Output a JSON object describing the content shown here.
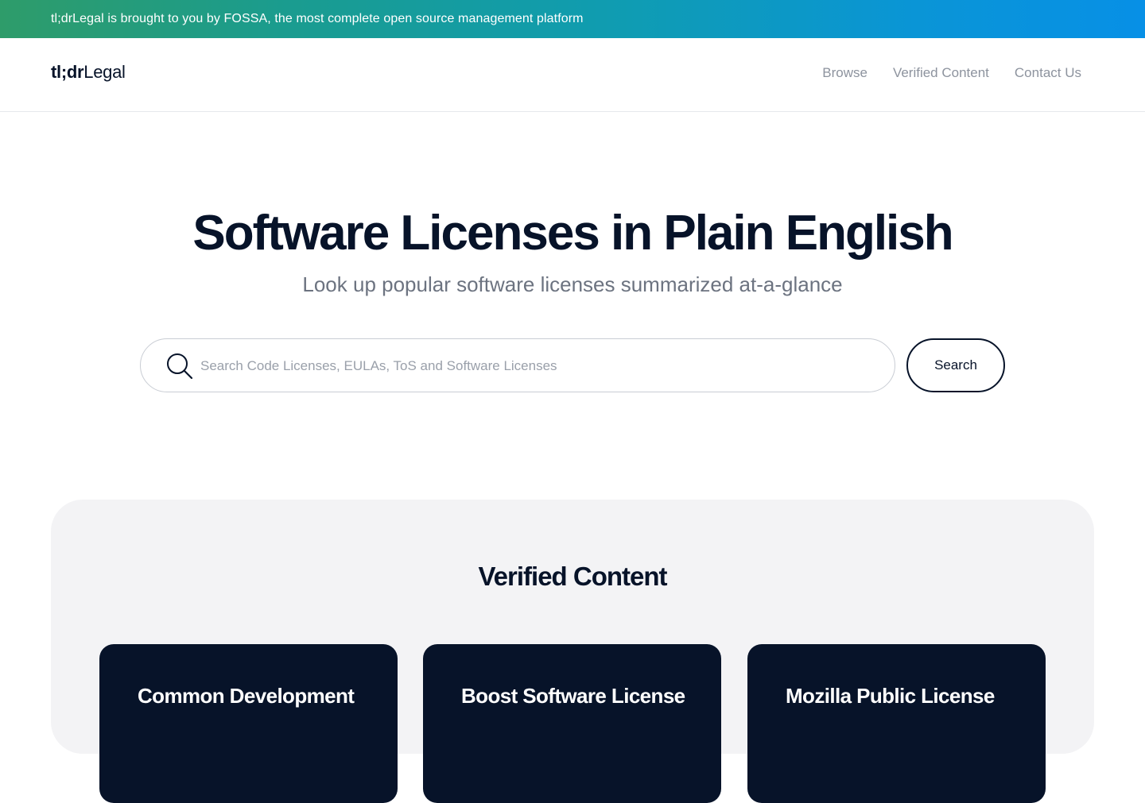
{
  "banner": {
    "text": "tl;drLegal is brought to you by FOSSA, the most complete open source management platform"
  },
  "header": {
    "logo_bold": "tl;dr",
    "logo_regular": "Legal",
    "nav": [
      "Browse",
      "Verified Content",
      "Contact Us"
    ]
  },
  "hero": {
    "title": "Software Licenses in Plain English",
    "subtitle": "Look up popular software licenses summarized at-a-glance"
  },
  "search": {
    "placeholder": "Search Code Licenses, EULAs, ToS and Software Licenses",
    "value": "",
    "button_label": "Search"
  },
  "verified": {
    "title": "Verified Content",
    "cards": [
      "Common Development",
      "Boost Software License",
      "Mozilla Public License"
    ]
  },
  "colors": {
    "navy": "#071329",
    "banner_start": "#2e9c6a",
    "banner_end": "#0790e6",
    "section_bg": "#f3f3f5",
    "nav_gray": "#8d939e"
  }
}
